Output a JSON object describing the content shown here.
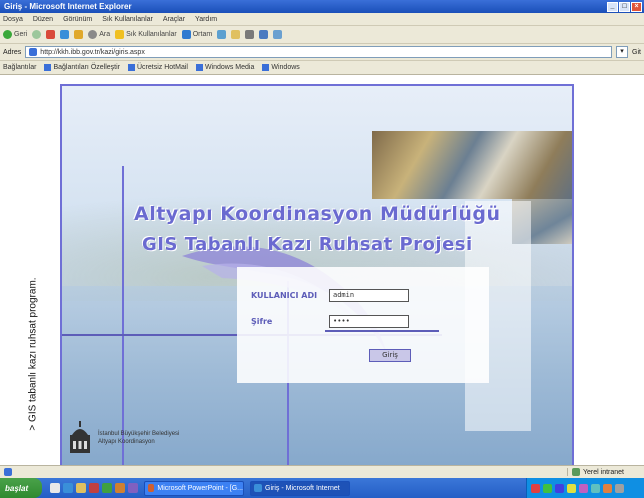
{
  "window": {
    "title": "Giriş - Microsoft Internet Explorer",
    "controls": [
      "_",
      "□",
      "×"
    ]
  },
  "menu": [
    "Dosya",
    "Düzen",
    "Görünüm",
    "Sık Kullanılanlar",
    "Araçlar",
    "Yardım"
  ],
  "toolbar": {
    "back": "Geri",
    "forward": "",
    "search": "Ara",
    "favorites": "Sık Kullanılanlar",
    "media": "Ortam"
  },
  "address": {
    "label": "Adres",
    "url": "http://kkh.ibb.gov.tr/kazi/giris.aspx",
    "go": "Git"
  },
  "links": {
    "label": "Bağlantılar",
    "items": [
      "Bağlantıları Özelleştir",
      "Ücretsiz HotMail",
      "Windows Media",
      "Windows"
    ]
  },
  "page": {
    "title_line1": "Altyapı Koordinasyon Müdürlüğü",
    "title_line2": "GIS Tabanlı Kazı Ruhsat Projesi",
    "login": {
      "username_label": "KULLANICI ADI",
      "username_value": "admin",
      "password_label": "Şifre",
      "password_value": "••••",
      "submit_label": "Giriş"
    },
    "logo_text_line1": "İstanbul Büyükşehir Belediyesi",
    "logo_text_line2": "Altyapı Koordinasyon"
  },
  "caption": "> GIS tabanlı kazı ruhsat program.",
  "status": {
    "text": "",
    "zone": "Yerel intranet"
  },
  "taskbar": {
    "start": "başlat",
    "tasks": [
      "Microsoft PowerPoint - [G...",
      "Giriş - Microsoft Internet"
    ],
    "colors": {
      "taskbar": "#245ec6",
      "start": "#2f8a2f",
      "accent": "#6a6ad0"
    }
  }
}
